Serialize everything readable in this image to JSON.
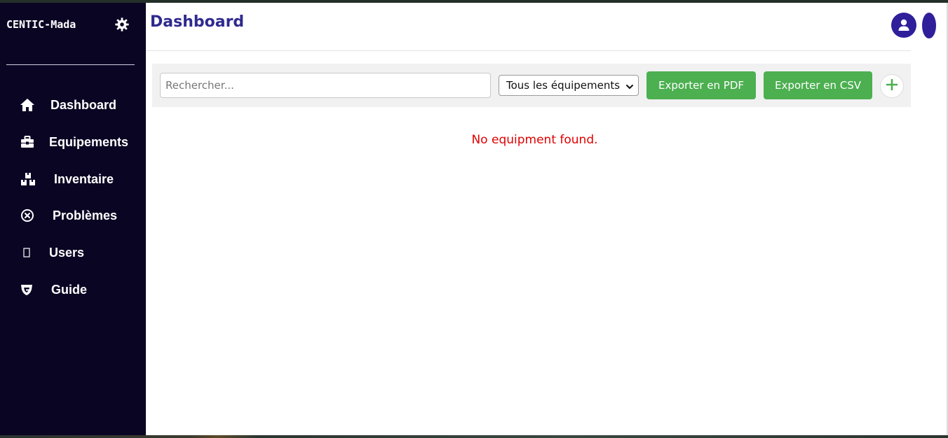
{
  "sidebar": {
    "brand": "CENTIC-Mada",
    "items": [
      {
        "label": "Dashboard",
        "icon": "home-icon"
      },
      {
        "label": "Equipements",
        "icon": "toolbox-icon"
      },
      {
        "label": "Inventaire",
        "icon": "boxes-icon"
      },
      {
        "label": "Problèmes",
        "icon": "circle-x-icon"
      },
      {
        "label": "Users",
        "icon": "missing-glyph-icon"
      },
      {
        "label": "Guide",
        "icon": "guide-shield-icon"
      }
    ]
  },
  "header": {
    "title": "Dashboard"
  },
  "toolbar": {
    "search_placeholder": "Rechercher...",
    "filter_selected": "Tous les équipements",
    "export_pdf_label": "Exporter en PDF",
    "export_csv_label": "Exporter en CSV"
  },
  "main": {
    "empty_message": "No equipment found."
  },
  "colors": {
    "sidebar_bg": "#0b0524",
    "title_color": "#2f2a8e",
    "accent_green": "#4caf50",
    "avatar_bg": "#2f1f9a",
    "error_red": "#e00000"
  }
}
